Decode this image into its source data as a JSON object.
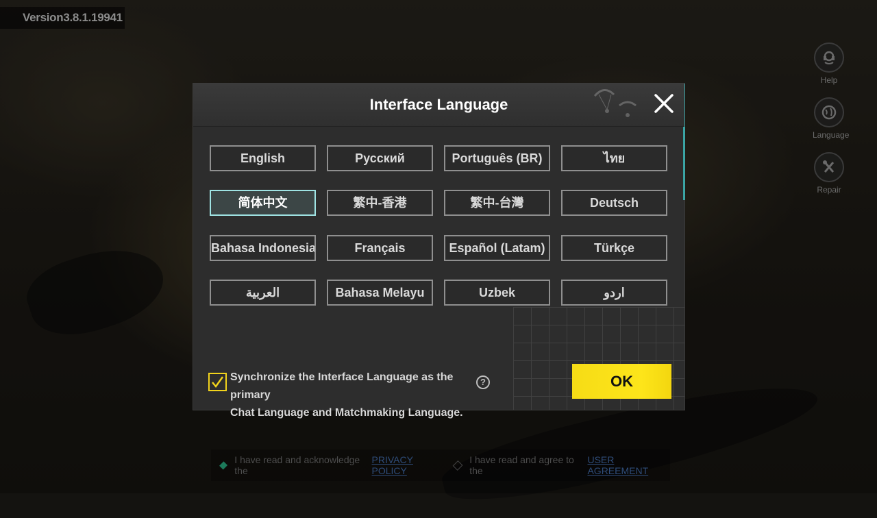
{
  "version": "Version3.8.1.19941",
  "side_buttons": [
    {
      "label": "Help",
      "icon": "headset-icon"
    },
    {
      "label": "Language",
      "icon": "globe-icon"
    },
    {
      "label": "Repair",
      "icon": "wrench-icon"
    }
  ],
  "dialog": {
    "title": "Interface Language",
    "languages": [
      "English",
      "Русский",
      "Português (BR)",
      "ไทย",
      "简体中文",
      "繁中-香港",
      "繁中-台灣",
      "Deutsch",
      "Bahasa Indonesia",
      "Français",
      "Español (Latam)",
      "Türkçe",
      "العربية",
      "Bahasa Melayu",
      "Uzbek",
      "اردو"
    ],
    "selected_language": "简体中文",
    "sync_checked": true,
    "sync_text_line1": "Synchronize the Interface Language as the primary",
    "sync_text_line2": "Chat Language and Matchmaking Language.",
    "help_symbol": "?",
    "ok_label": "OK"
  },
  "footer": {
    "privacy_prefix": "I have read and acknowledge the",
    "privacy_link": "PRIVACY POLICY",
    "agreement_prefix": "I have read and agree to the",
    "agreement_link": "USER AGREEMENT"
  },
  "colors": {
    "accent_yellow": "#f6dc16",
    "selected_border": "#9fe3e3",
    "checkbox_border": "#f2d41c"
  }
}
